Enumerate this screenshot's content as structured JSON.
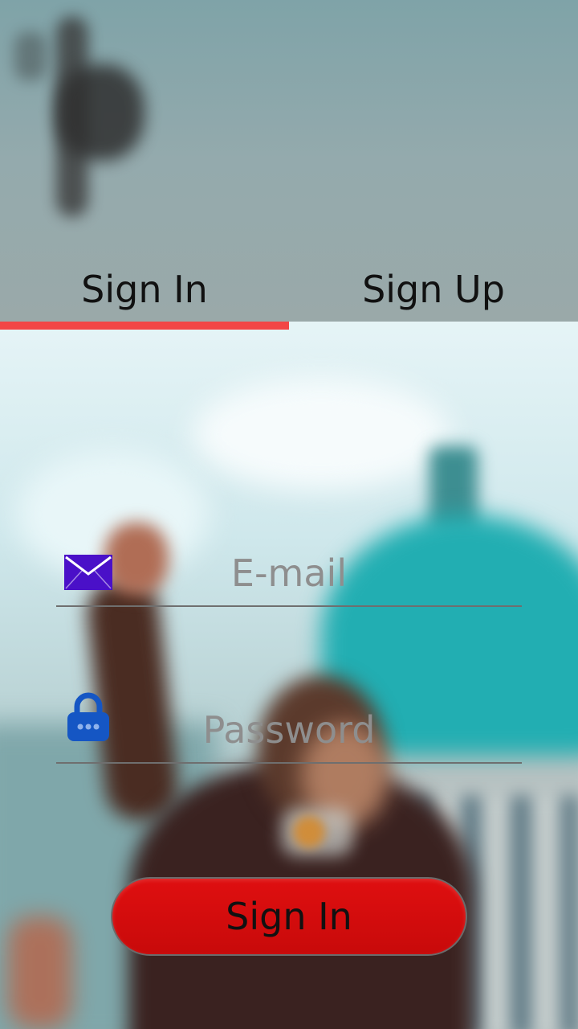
{
  "tabs": {
    "sign_in": "Sign In",
    "sign_up": "Sign Up",
    "active": "sign_in"
  },
  "form": {
    "email_placeholder": "E-mail",
    "email_value": "",
    "password_placeholder": "Password",
    "password_value": "",
    "submit_label": "Sign In"
  },
  "icons": {
    "email": "envelope-icon",
    "password": "lock-icon"
  },
  "colors": {
    "accent": "#f24646",
    "button": "#d40d0d",
    "envelope": "#4a10c8",
    "lock": "#1556c4"
  }
}
